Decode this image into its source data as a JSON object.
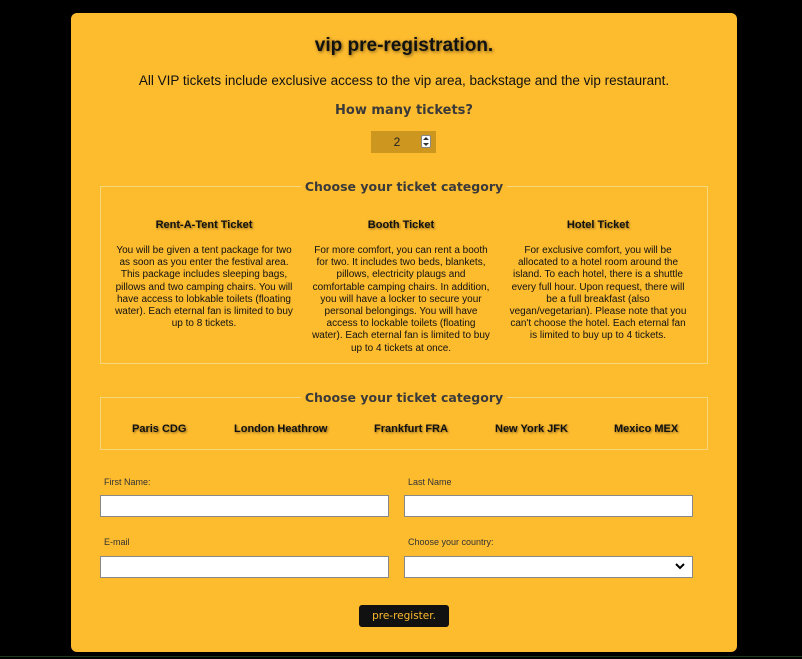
{
  "page": {
    "title": "vip pre-registration.",
    "subtitle": "All VIP tickets include exclusive access to the vip area, backstage and the vip restaurant.",
    "ticket_count_label": "How many tickets?",
    "ticket_count_value": "2"
  },
  "categories": {
    "legend": "Choose your ticket category",
    "items": [
      {
        "title": "Rent-A-Tent Ticket",
        "description": "You will be given a tent package for two as soon as you enter the festival area. This package includes sleeping bags, pillows and two camping chairs. You will have access to lobkable toilets (floating water). Each eternal fan is limited to buy up to 8 tickets."
      },
      {
        "title": "Booth Ticket",
        "description": "For more comfort, you can rent a booth for two. It includes two beds, blankets, pillows, electricity plaugs and comfortable camping chairs. In addition, you will have a locker to secure your personal belongings. You will have access to lockable toilets (floating water). Each eternal fan is limited to buy up to 4 tickets at once."
      },
      {
        "title": "Hotel Ticket",
        "description": "For exclusive comfort, you will be allocated to a hotel room around the island. To each hotel, there is a shuttle every full hour. Upon request, there will be a full breakfast (also vegan/vegetarian). Please note that you can't choose the hotel. Each eternal fan is limited to buy up to 4 tickets."
      }
    ]
  },
  "airports": {
    "legend": "Choose your ticket category",
    "items": [
      "Paris CDG",
      "London Heathrow",
      "Frankfurt FRA",
      "New York JFK",
      "Mexico MEX"
    ]
  },
  "form": {
    "first_name_label": "First Name:",
    "first_name_value": "",
    "last_name_label": "Last Name",
    "last_name_value": "",
    "email_label": "E-mail",
    "email_value": "",
    "country_label": "Choose your country:",
    "country_value": "",
    "submit_label": "pre-register."
  },
  "colors": {
    "background": "#000000",
    "card": "#FDBB2E",
    "stepper": "#CC961F",
    "button": "#111111",
    "button_text": "#FDBB2E"
  }
}
